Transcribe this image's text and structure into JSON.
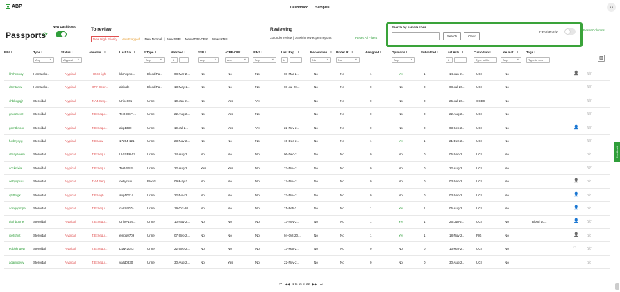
{
  "app": {
    "logo_text": "ABP",
    "avatar": "AA"
  },
  "nav": [
    "Dashboard",
    "Samples"
  ],
  "page": {
    "title": "Passports",
    "new_dashboard_label": "New Dashboard"
  },
  "to_review": {
    "title": "To review",
    "links": [
      "New High Priority",
      "New Flagged",
      "New Normal",
      "New SSP",
      "New ATPF-CPR",
      "New IRMS"
    ]
  },
  "reviewing": {
    "title": "Reviewing",
    "subtitle": "33 under review | 16 with new expert reports",
    "reset_filters": "Reset All Filters"
  },
  "search": {
    "label": "Search by sample code",
    "value": "",
    "search_button": "Search",
    "clear_button": "Clear",
    "favorite_label": "Favorite only"
  },
  "reset_columns": "Reset Columns",
  "columns": [
    "BP#",
    "Type",
    "Status",
    "Abnorm...",
    "Last Sa...",
    "S.Type",
    "Matched",
    "SSP",
    "ATPF-CPR",
    "IRMS",
    "Last Rep...",
    "Recommen...",
    "Under R...",
    "Assigned",
    "Opinions",
    "Submitted",
    "Last Acti...",
    "Custodian",
    "Late mat...",
    "Tags"
  ],
  "filters": {
    "type": "Any",
    "status": "Atypical",
    "stype": "Any",
    "matched": "≥",
    "ssp": "Any",
    "atpf": "Any",
    "irms": "Any",
    "last_rep": "≥",
    "recommen": "No",
    "under_r": "No",
    "opinions": "Any",
    "last_acti": "≥",
    "custodian_placeholder": "Type to filte",
    "late": "Any",
    "tags_placeholder": "Type to sea"
  },
  "rows": [
    [
      "khrhcpnoy",
      "Hematolo...",
      "Atypical",
      "HGB High",
      "khrhcpno...",
      "Blood Pa...",
      "08-Mar-2...",
      "No",
      "No",
      "No",
      "08-Mar-2...",
      "No",
      "No",
      "1",
      "Yes",
      "1",
      "14-Jun-2...",
      "UCI",
      "No",
      "",
      "user",
      "star"
    ],
    [
      "dttmtanwl",
      "Hematolo...",
      "Atypical",
      "OFF-Scor...",
      "altitude",
      "Blood Pa...",
      "13-May-2...",
      "No",
      "No",
      "No",
      "08-Jul-20...",
      "No",
      "No",
      "0",
      "No",
      "0",
      "08-Jul-20...",
      "UCI",
      "No",
      "",
      "none",
      "star"
    ],
    [
      "chbbcgqjz",
      "Steroidal",
      "Atypical",
      "T/A4 Seq...",
      "Urine001",
      "Urine",
      "10-Jan-2...",
      "No",
      "Yes",
      "Yes",
      "",
      "No",
      "No",
      "0",
      "No",
      "0",
      "25-Jul-20...",
      "CCES",
      "No",
      "",
      "none",
      "star"
    ],
    [
      "gruezsecz",
      "Steroidal",
      "Atypical",
      "T/E Sequ...",
      "Test-SSP-...",
      "Urine",
      "22-Aug-2...",
      "No",
      "Yes",
      "No",
      "",
      "No",
      "No",
      "0",
      "No",
      "0",
      "22-Aug-2...",
      "UCI",
      "No",
      "",
      "none",
      "star"
    ],
    [
      "gemtbnoox",
      "Steroidal",
      "Atypical",
      "T/E Sequ...",
      "abp1330",
      "Urine",
      "19-Jul-2...",
      "No",
      "Yes",
      "Yes",
      "22-Nov-2...",
      "No",
      "No",
      "0",
      "No",
      "0",
      "03-Sep-2...",
      "UCI",
      "No",
      "",
      "userblue",
      "star"
    ],
    [
      "fucbryoyg",
      "Steroidal",
      "Atypical",
      "T/E Low",
      "17254-121",
      "Urine",
      "23-Nov-2...",
      "No",
      "No",
      "No",
      "15-Dec-2...",
      "No",
      "No",
      "1",
      "Yes",
      "1",
      "21-Dec-2...",
      "UCI",
      "No",
      "",
      "none",
      "star"
    ],
    [
      "dtbayzowm",
      "Steroidal",
      "Atypical",
      "T/E Sequ...",
      "U-SSP6-02",
      "Urine",
      "14-Aug-2...",
      "No",
      "No",
      "No",
      "06-Dec-2...",
      "No",
      "No",
      "0",
      "No",
      "0",
      "05-Sep-2...",
      "UCI",
      "No",
      "",
      "none",
      "star"
    ],
    [
      "cccknixia",
      "Steroidal",
      "Atypical",
      "T/E Sequ...",
      "Test-SSP-...",
      "Urine",
      "22-Aug-2...",
      "Yes",
      "Yes",
      "No",
      "22-Nov-2...",
      "No",
      "No",
      "0",
      "No",
      "0",
      "22-Aug-2...",
      "UCI",
      "No",
      "",
      "none",
      "star"
    ],
    [
      "oebycpiuu",
      "Steroidal",
      "Atypical",
      "T/A4 Seq...",
      "oebyciuu...",
      "Blood",
      "09-May-2...",
      "No",
      "No",
      "No",
      "17-Nov-2...",
      "No",
      "No",
      "0",
      "No",
      "0",
      "03-Sep-2...",
      "UCI",
      "No",
      "",
      "user",
      "star"
    ],
    [
      "qfsftnlgk",
      "Steroidal",
      "Atypical",
      "T/E High",
      "abp1021a",
      "Urine",
      "22-Nov-2...",
      "No",
      "No",
      "No",
      "22-Nov-2...",
      "No",
      "No",
      "0",
      "No",
      "0",
      "03-Sep-2...",
      "UCI",
      "No",
      "",
      "userblue",
      "star"
    ],
    [
      "aqrigqdmpe",
      "Steroidal",
      "Atypical",
      "T/E Sequ...",
      "calc0707a",
      "Urine",
      "19-Oct-20...",
      "No",
      "No",
      "No",
      "21-Feb-2...",
      "No",
      "No",
      "1",
      "Yes",
      "1",
      "05-Aug-2...",
      "UCI",
      "No",
      "",
      "userblue",
      "star"
    ],
    [
      "dtbhbgbne",
      "Steroidal",
      "Atypical",
      "T/E Sequ...",
      "Urine-109...",
      "Urine",
      "10-Nov-2...",
      "No",
      "No",
      "No",
      "13-Nov-2...",
      "No",
      "No",
      "1",
      "Yes",
      "1",
      "26-Jun-2...",
      "UCI",
      "No",
      "Blood do...",
      "userblue",
      "star"
    ],
    [
      "igetshict",
      "Steroidal",
      "Atypical",
      "T/E Sequ...",
      "emgo0709",
      "Urine",
      "07-Sep-2...",
      "No",
      "No",
      "No",
      "04-Oct-20...",
      "No",
      "No",
      "1",
      "Yes",
      "1",
      "18-Nov-2...",
      "FIG",
      "No",
      "",
      "user",
      "star"
    ],
    [
      "eobhknqew",
      "Steroidal",
      "Atypical",
      "T/E Sequ...",
      "LMW2023",
      "Urine",
      "22-Sep-2...",
      "No",
      "No",
      "No",
      "13-Mar-2...",
      "No",
      "No",
      "0",
      "No",
      "0",
      "13-Mar-2...",
      "UCI",
      "No",
      "",
      "circle",
      "star"
    ],
    [
      "acamjgeov",
      "Steroidal",
      "Atypical",
      "T/E Sequ...",
      "valid0830",
      "Urine",
      "30-Aug-2...",
      "No",
      "Yes",
      "No",
      "22-Nov-2...",
      "No",
      "No",
      "0",
      "No",
      "0",
      "30-Aug-2...",
      "UCI",
      "No",
      "",
      "none",
      "star"
    ]
  ],
  "pager": {
    "text": "1 to 15 of 22"
  },
  "feedback": "Feedback",
  "colors": {
    "accent": "#2f9e3a",
    "red": "#e05050",
    "orange": "#e8a23a"
  }
}
